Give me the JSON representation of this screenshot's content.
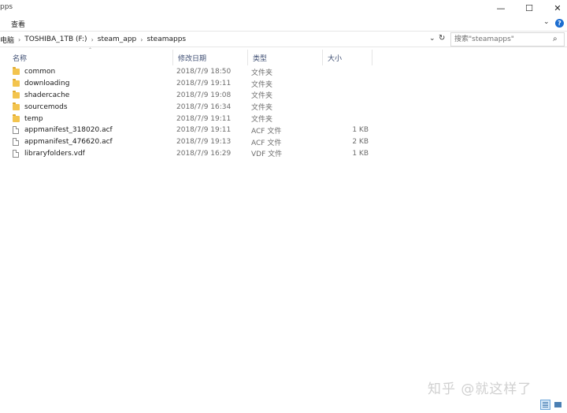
{
  "window": {
    "title": "pps",
    "controls": {
      "minimize": "—",
      "maximize": "☐",
      "close": "✕"
    }
  },
  "ribbon": {
    "tab_view": "查看",
    "expand_glyph": "⌄",
    "help_glyph": "?"
  },
  "address": {
    "crumbs": [
      "电脑",
      "TOSHIBA_1TB (F:)",
      "steam_app",
      "steamapps"
    ],
    "separator": "›",
    "dropdown_glyph": "⌄",
    "refresh_glyph": "↻"
  },
  "search": {
    "placeholder": "搜索\"steamapps\"",
    "icon_glyph": "⌕"
  },
  "list": {
    "sort_glyph": "⌃",
    "columns": {
      "name": "名称",
      "date": "修改日期",
      "type": "类型",
      "size": "大小"
    },
    "rows": [
      {
        "kind": "folder",
        "name": "common",
        "date": "2018/7/9 18:50",
        "type": "文件夹",
        "size": ""
      },
      {
        "kind": "folder",
        "name": "downloading",
        "date": "2018/7/9 19:11",
        "type": "文件夹",
        "size": ""
      },
      {
        "kind": "folder",
        "name": "shadercache",
        "date": "2018/7/9 19:08",
        "type": "文件夹",
        "size": ""
      },
      {
        "kind": "folder",
        "name": "sourcemods",
        "date": "2018/7/9 16:34",
        "type": "文件夹",
        "size": ""
      },
      {
        "kind": "folder",
        "name": "temp",
        "date": "2018/7/9 19:11",
        "type": "文件夹",
        "size": ""
      },
      {
        "kind": "file",
        "name": "appmanifest_318020.acf",
        "date": "2018/7/9 19:11",
        "type": "ACF 文件",
        "size": "1 KB"
      },
      {
        "kind": "file",
        "name": "appmanifest_476620.acf",
        "date": "2018/7/9 19:13",
        "type": "ACF 文件",
        "size": "2 KB"
      },
      {
        "kind": "file",
        "name": "libraryfolders.vdf",
        "date": "2018/7/9 16:29",
        "type": "VDF 文件",
        "size": "1 KB"
      }
    ]
  },
  "watermark": "知乎 @就这样了",
  "colors": {
    "folder": "#f3c44e",
    "header_text": "#3d4d72",
    "accent": "#1c6dd0"
  }
}
